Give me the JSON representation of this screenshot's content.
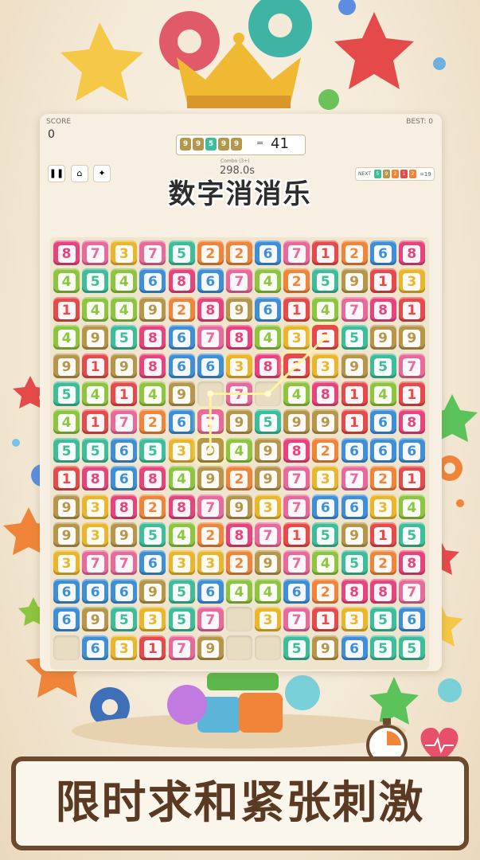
{
  "game": {
    "title": "数字消消乐",
    "slogan": "限时求和紧张刺激"
  },
  "hud": {
    "score_label": "SCORE",
    "score_value": "0",
    "best_label": "BEST: 0",
    "target_digits": [
      "9",
      "9",
      "5",
      "9",
      "9"
    ],
    "target_eq": "=",
    "target_sum": "41",
    "combo_label": "Combo (3+)",
    "timer": "298.0s",
    "next_label": "NEXT",
    "next_digits": [
      "5",
      "9",
      "2",
      "1",
      "2"
    ],
    "next_sum": "=19",
    "pause_icon": "pause-icon",
    "home_icon": "home-icon",
    "hint_icon": "hint-wand-icon"
  },
  "colors": {
    "1": "#e74a4a",
    "2": "#f0853a",
    "3": "#e9b62c",
    "4": "#8dc53f",
    "5": "#3dbd9a",
    "6": "#3e8fd8",
    "7": "#e96a9a",
    "8": "#e8437c",
    "9": "#b5964a"
  },
  "board": {
    "rows": [
      [
        "8",
        "7",
        "3",
        "7",
        "5",
        "2",
        "2",
        "6",
        "7",
        "1",
        "2",
        "6",
        "8"
      ],
      [
        "4",
        "5",
        "4",
        "6",
        "8",
        "6",
        "7",
        "4",
        "2",
        "5",
        "9",
        "1",
        "3"
      ],
      [
        "1",
        "4",
        "4",
        "9",
        "2",
        "8",
        "9",
        "6",
        "1",
        "4",
        "7",
        "8",
        "1"
      ],
      [
        "4",
        "9",
        "5",
        "8",
        "6",
        "7",
        "8",
        "4",
        "3",
        "1",
        "5",
        "9",
        "9"
      ],
      [
        "9",
        "1",
        "9",
        "8",
        "6",
        "6",
        "3",
        "8",
        "1",
        "3",
        "9",
        "5",
        "7"
      ],
      [
        "5",
        "4",
        "1",
        "4",
        "9",
        "",
        "7",
        "",
        "4",
        "8",
        "1",
        "4",
        "1"
      ],
      [
        "4",
        "1",
        "7",
        "2",
        "6",
        "7",
        "9",
        "5",
        "9",
        "9",
        "1",
        "6",
        "8"
      ],
      [
        "5",
        "5",
        "6",
        "5",
        "3",
        "9",
        "4",
        "9",
        "8",
        "2",
        "6",
        "6",
        "6"
      ],
      [
        "1",
        "8",
        "6",
        "8",
        "4",
        "9",
        "2",
        "9",
        "7",
        "3",
        "7",
        "2",
        "1"
      ],
      [
        "9",
        "3",
        "8",
        "2",
        "8",
        "7",
        "9",
        "3",
        "7",
        "6",
        "6",
        "3",
        "4"
      ],
      [
        "9",
        "3",
        "9",
        "5",
        "4",
        "2",
        "8",
        "7",
        "1",
        "5",
        "9",
        "1",
        "5"
      ],
      [
        "3",
        "7",
        "7",
        "6",
        "3",
        "3",
        "2",
        "9",
        "7",
        "4",
        "5",
        "2",
        "8"
      ],
      [
        "6",
        "6",
        "6",
        "9",
        "5",
        "6",
        "4",
        "4",
        "6",
        "2",
        "8",
        "8",
        "7"
      ],
      [
        "6",
        "9",
        "5",
        "3",
        "5",
        "7",
        "",
        "3",
        "7",
        "1",
        "3",
        "5",
        "6"
      ],
      [
        "",
        "6",
        "3",
        "1",
        "7",
        "9",
        "",
        "",
        "5",
        "9",
        "6",
        "5",
        "5"
      ]
    ],
    "selected_path": [
      [
        5,
        5
      ],
      [
        5,
        7
      ],
      [
        4,
        8
      ],
      [
        3,
        9
      ],
      [
        6,
        5
      ],
      [
        7,
        5
      ]
    ]
  }
}
